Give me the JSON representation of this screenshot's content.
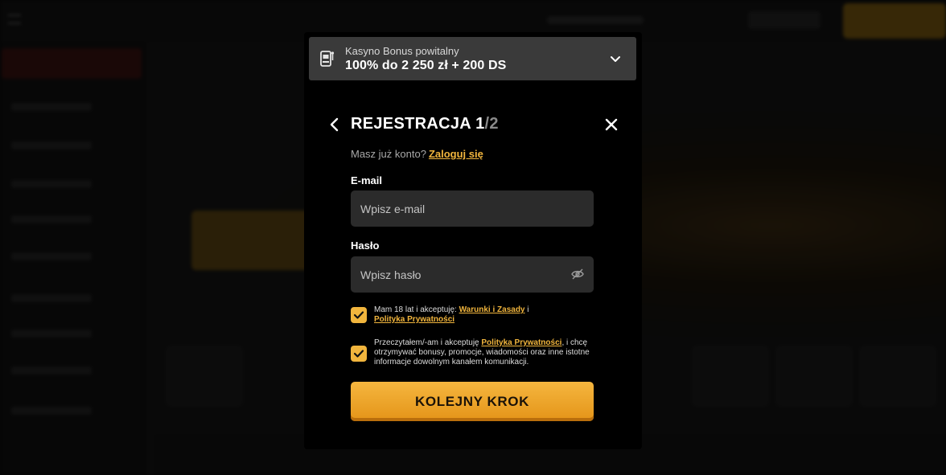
{
  "bonus": {
    "subtitle": "Kasyno Bonus powitalny",
    "title": "100% do 2 250 zł + 200 DS",
    "icon": "slot-machine-icon",
    "chevron": "chevron-down-icon"
  },
  "registration": {
    "title": "REJESTRACJA 1",
    "step_total": "/2",
    "have_account": "Masz już konto?",
    "login_link": "Zaloguj się"
  },
  "email": {
    "label": "E-mail",
    "placeholder": "Wpisz e-mail",
    "value": ""
  },
  "password": {
    "label": "Hasło",
    "placeholder": "Wpisz hasło",
    "value": ""
  },
  "consent_terms": {
    "checked": true,
    "text_before": "Mam 18 lat i akceptuję: ",
    "link1": "Warunki i Zasady",
    "text_mid": " i",
    "link2": "Polityka Prywatności"
  },
  "consent_marketing": {
    "checked": true,
    "text_before": "Przeczytałem/-am i akceptuję ",
    "link": "Polityka Prywatności",
    "text_after": ", i chcę otrzymywać bonusy, promocje, wiadomości oraz inne istotne informacje dowolnym kanałem komunikacji."
  },
  "cta_label": "KOLEJNY KROK",
  "colors": {
    "accent": "#f1b53d",
    "cta_top": "#f5b63f",
    "cta_bottom": "#e49418",
    "modal_bg": "#000000",
    "field_bg": "#2b2b2b"
  }
}
